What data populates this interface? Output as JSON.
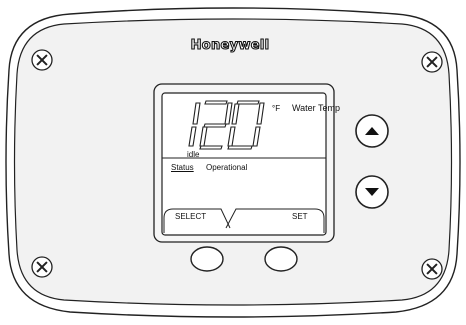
{
  "device": {
    "brand": "Honeywell",
    "display": {
      "temperature": "120",
      "unit": "°F",
      "parameter_label": "Water Temp",
      "mode": "idle",
      "status_label": "Status",
      "status_value": "Operational",
      "softkey_left": "SELECT",
      "softkey_right": "SET"
    },
    "buttons": [
      "up-arrow",
      "down-arrow",
      "left-softkey-button",
      "right-softkey-button"
    ]
  }
}
